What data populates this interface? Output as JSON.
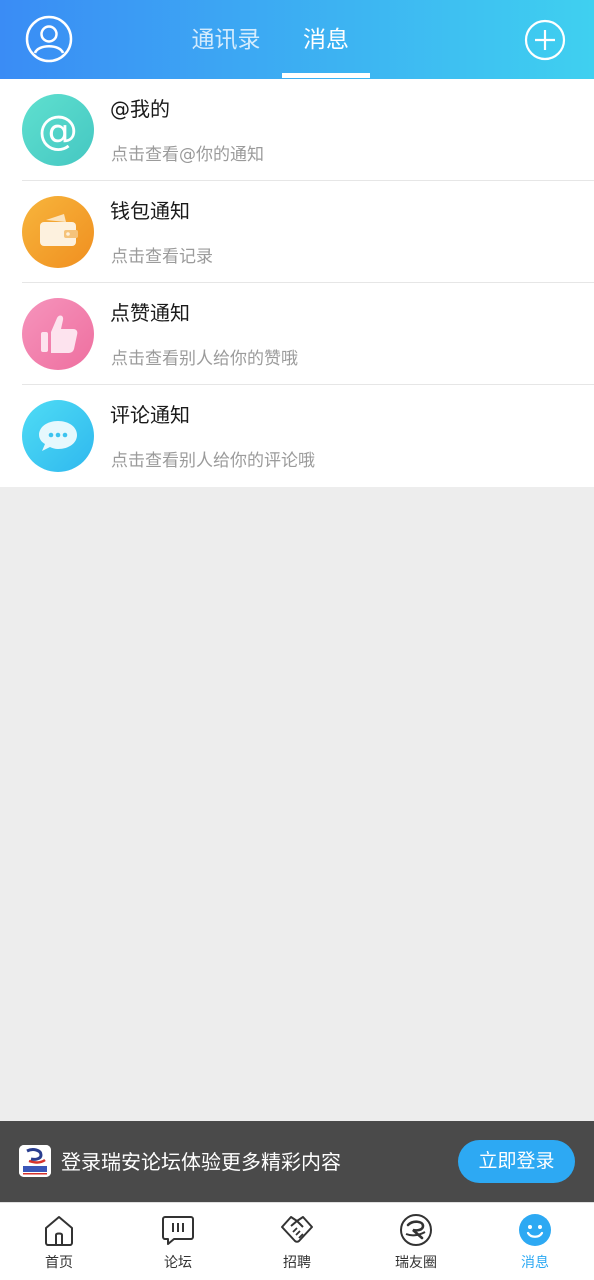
{
  "header": {
    "tabs": [
      {
        "label": "通讯录",
        "active": false
      },
      {
        "label": "消息",
        "active": true
      }
    ],
    "avatar_icon": "user-circle-icon",
    "add_icon": "plus-circle-icon"
  },
  "messages": [
    {
      "title": "@我的",
      "subtitle": "点击查看@你的通知",
      "icon": "at-icon",
      "color": "#4fd3c4"
    },
    {
      "title": "钱包通知",
      "subtitle": "点击查看记录",
      "icon": "wallet-icon",
      "color": "#f5a32b"
    },
    {
      "title": "点赞通知",
      "subtitle": "点击查看别人给你的赞哦",
      "icon": "thumbs-up-icon",
      "color": "#f37aa8"
    },
    {
      "title": "评论通知",
      "subtitle": "点击查看别人给你的评论哦",
      "icon": "comment-icon",
      "color": "#3ecbf2"
    }
  ],
  "login_banner": {
    "text": "登录瑞安论坛体验更多精彩内容",
    "button": "立即登录"
  },
  "bottom_nav": [
    {
      "label": "首页",
      "icon": "home-icon",
      "active": false
    },
    {
      "label": "论坛",
      "icon": "forum-icon",
      "active": false
    },
    {
      "label": "招聘",
      "icon": "handshake-icon",
      "active": false
    },
    {
      "label": "瑞友圈",
      "icon": "ruiyou-circle-icon",
      "active": false
    },
    {
      "label": "消息",
      "icon": "smile-icon",
      "active": true
    }
  ],
  "colors": {
    "header_start": "#3a8cf5",
    "header_end": "#3fd0f0",
    "accent": "#2da9f3"
  }
}
